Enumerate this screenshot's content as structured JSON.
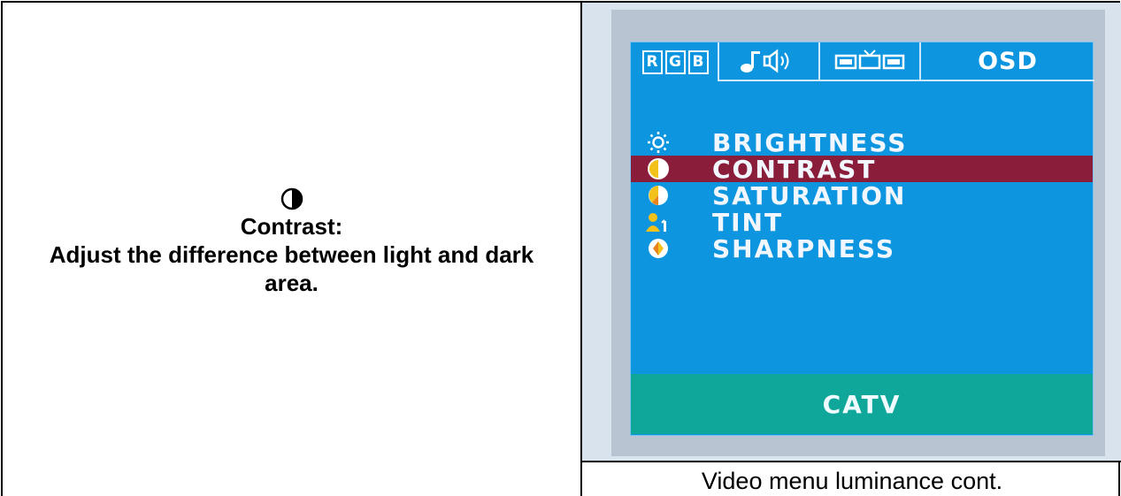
{
  "description": {
    "icon": "contrast-half-circle-icon",
    "title": "Contrast:",
    "body": "Adjust the difference between light and dark area."
  },
  "osd": {
    "tabs": [
      {
        "id": "picture",
        "letters": [
          "R",
          "G",
          "B"
        ],
        "active": true
      },
      {
        "id": "audio",
        "icon": "music-speaker-icon"
      },
      {
        "id": "display",
        "icon": "screens-tv-icon"
      },
      {
        "id": "osd",
        "label": "OSD"
      }
    ],
    "items": [
      {
        "label": "BRIGHTNESS",
        "icon": "sun-icon",
        "selected": false
      },
      {
        "label": "CONTRAST",
        "icon": "contrast-icon",
        "selected": true
      },
      {
        "label": "SATURATION",
        "icon": "saturation-icon",
        "selected": false
      },
      {
        "label": "TINT",
        "icon": "tint-person-icon",
        "selected": false
      },
      {
        "label": "SHARPNESS",
        "icon": "sharpness-icon",
        "selected": false
      }
    ],
    "source": "CATV",
    "colors": {
      "background": "#0e95df",
      "selection": "#8a1d39",
      "source_bar": "#0fa79a"
    }
  },
  "caption": "Video menu luminance cont."
}
